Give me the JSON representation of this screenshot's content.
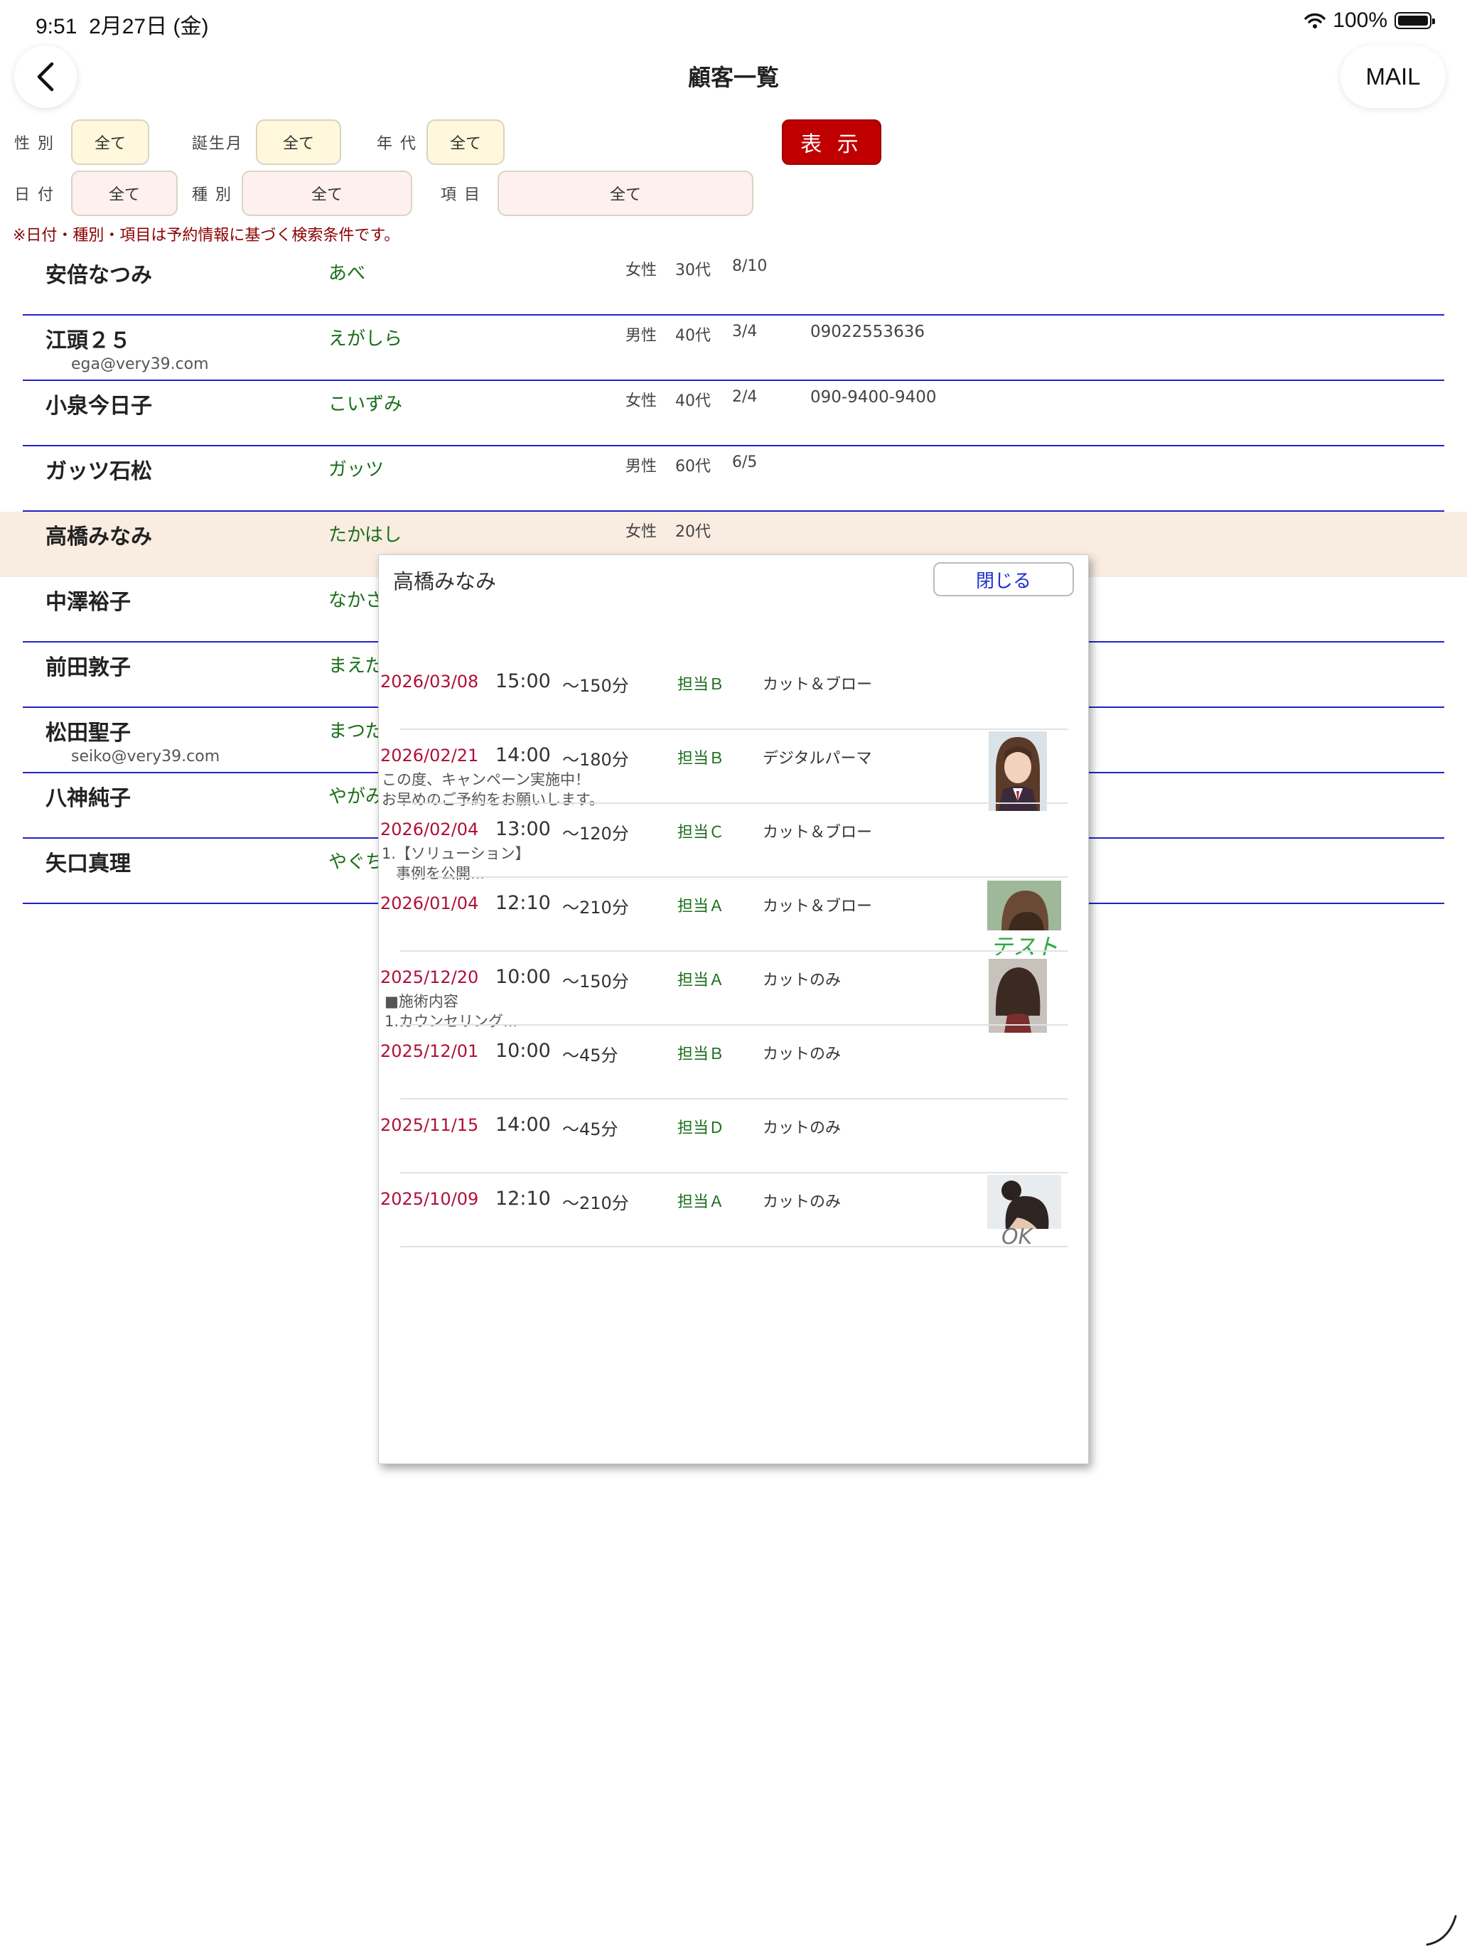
{
  "status_bar": {
    "time": "9:51",
    "date": "2月27日 (金)",
    "wifi_icon": "wifi-icon",
    "battery": "100%",
    "battery_icon": "battery-icon"
  },
  "nav": {
    "back_icon": "chevron-left-icon",
    "title": "顧客一覧",
    "mail_label": "MAIL"
  },
  "filters": {
    "gender": {
      "label": "性 別",
      "value": "全て"
    },
    "birth_month": {
      "label": "誕生月",
      "value": "全て"
    },
    "age_group": {
      "label": "年 代",
      "value": "全て"
    },
    "date": {
      "label": "日 付",
      "value": "全て"
    },
    "type": {
      "label": "種 別",
      "value": "全て"
    },
    "item": {
      "label": "項 目",
      "value": "全て"
    },
    "show_label": "表 示",
    "note": "※日付・種別・項目は予約情報に基づく検索条件です。",
    "colors": {
      "yellow_button": "#fff8dc",
      "pink_button": "#fdf0ee",
      "show_button": "#c00000"
    }
  },
  "customers": [
    {
      "name": "安倍なつみ",
      "kana": "あべ",
      "sex": "女性",
      "age": "30代",
      "birthday": "8/10",
      "phone": "",
      "email": ""
    },
    {
      "name": "江頭２５",
      "kana": "えがしら",
      "sex": "男性",
      "age": "40代",
      "birthday": "3/4",
      "phone": "09022553636",
      "email": "ega@very39.com"
    },
    {
      "name": "小泉今日子",
      "kana": "こいずみ",
      "sex": "女性",
      "age": "40代",
      "birthday": "2/4",
      "phone": "090-9400-9400",
      "email": ""
    },
    {
      "name": "ガッツ石松",
      "kana": "ガッツ",
      "sex": "男性",
      "age": "60代",
      "birthday": "6/5",
      "phone": "",
      "email": ""
    },
    {
      "name": "高橋みなみ",
      "kana": "たかはし",
      "sex": "女性",
      "age": "20代",
      "birthday": "",
      "phone": "",
      "email": "",
      "selected": true
    },
    {
      "name": "中澤裕子",
      "kana": "なかさ",
      "sex": "",
      "age": "",
      "birthday": "",
      "phone": "",
      "email": ""
    },
    {
      "name": "前田敦子",
      "kana": "まえだ",
      "sex": "",
      "age": "",
      "birthday": "",
      "phone": "",
      "email": ""
    },
    {
      "name": "松田聖子",
      "kana": "まつだ",
      "sex": "",
      "age": "",
      "birthday": "",
      "phone": "",
      "email": "seiko@very39.com"
    },
    {
      "name": "八神純子",
      "kana": "やがみ",
      "sex": "",
      "age": "",
      "birthday": "",
      "phone": "",
      "email": ""
    },
    {
      "name": "矢口真理",
      "kana": "やぐち",
      "sex": "",
      "age": "",
      "birthday": "",
      "phone": "",
      "email": ""
    }
  ],
  "popup": {
    "title": "高橋みなみ",
    "close_label": "閉じる",
    "history": [
      {
        "date": "2026/03/08",
        "time": "15:00",
        "duration": "～150分",
        "staff": "担当Ｂ",
        "menu": "カット＆ブロー",
        "memo": "",
        "photo": ""
      },
      {
        "date": "2026/02/21",
        "time": "14:00",
        "duration": "～180分",
        "staff": "担当Ｂ",
        "menu": "デジタルパーマ",
        "memo": "この度、キャンペーン実施中！\nお早めのご予約をお願いします。",
        "photo": "girl-portrait-photo"
      },
      {
        "date": "2026/02/04",
        "time": "13:00",
        "duration": "～120分",
        "staff": "担当Ｃ",
        "menu": "カット＆ブロー",
        "memo": "1.【ソリューション】\n   事例を公開...",
        "photo": ""
      },
      {
        "date": "2026/01/04",
        "time": "12:10",
        "duration": "～210分",
        "staff": "担当Ａ",
        "menu": "カット＆ブロー",
        "memo": "",
        "photo": "bob-hair-photo",
        "photo_note": "テスト"
      },
      {
        "date": "2025/12/20",
        "time": "10:00",
        "duration": "～150分",
        "staff": "担当Ａ",
        "menu": "カットのみ",
        "memo": "■施術内容\n1.カウンセリング...",
        "photo": "short-hair-photo"
      },
      {
        "date": "2025/12/01",
        "time": "10:00",
        "duration": "～45分",
        "staff": "担当Ｂ",
        "menu": "カットのみ",
        "memo": "",
        "photo": ""
      },
      {
        "date": "2025/11/15",
        "time": "14:00",
        "duration": "～45分",
        "staff": "担当Ｄ",
        "menu": "カットのみ",
        "memo": "",
        "photo": ""
      },
      {
        "date": "2025/10/09",
        "time": "12:10",
        "duration": "～210分",
        "staff": "担当Ａ",
        "menu": "カットのみ",
        "memo": "",
        "photo": "updo-hair-photo",
        "photo_note": "OK"
      }
    ]
  }
}
